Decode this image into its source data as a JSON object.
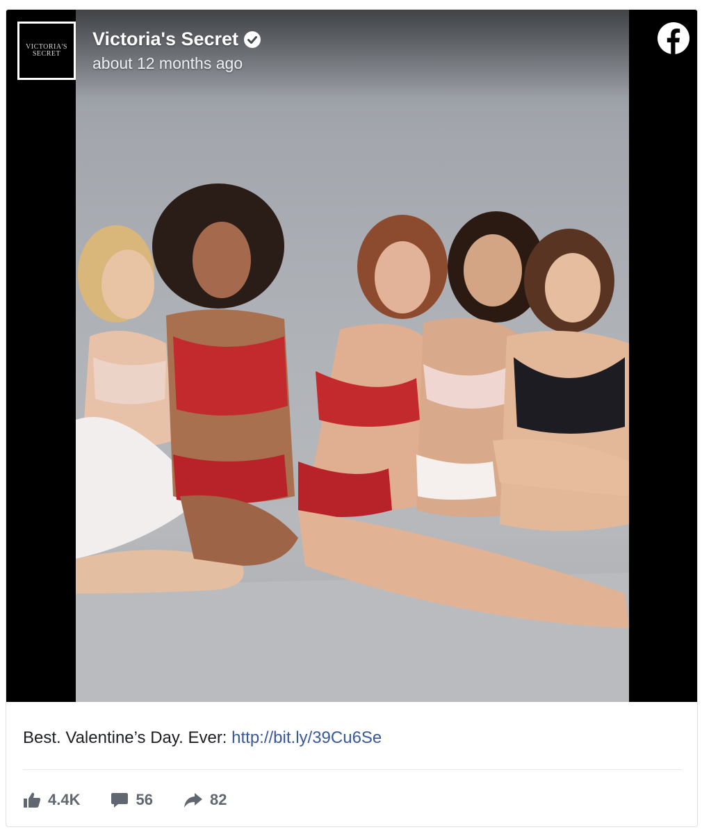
{
  "post": {
    "author": "Victoria's Secret",
    "verified": true,
    "timestamp": "about 12 months ago",
    "avatar": {
      "line1": "VICTORIA'S",
      "line2": "SECRET"
    },
    "caption_text": "Best. Valentine’s Day. Ever: ",
    "caption_link": "http://bit.ly/39Cu6Se",
    "image_alt": "five women in lingerie seated on a grey studio floor"
  },
  "stats": {
    "likes": "4.4K",
    "comments": "56",
    "shares": "82"
  },
  "icons": {
    "brand": "facebook-icon",
    "verified": "verified-badge-icon",
    "like": "thumbs-up-icon",
    "comment": "comment-icon",
    "share": "share-arrow-icon"
  },
  "colors": {
    "link": "#385898",
    "stats_text": "#606770",
    "media_background": "#000000"
  }
}
